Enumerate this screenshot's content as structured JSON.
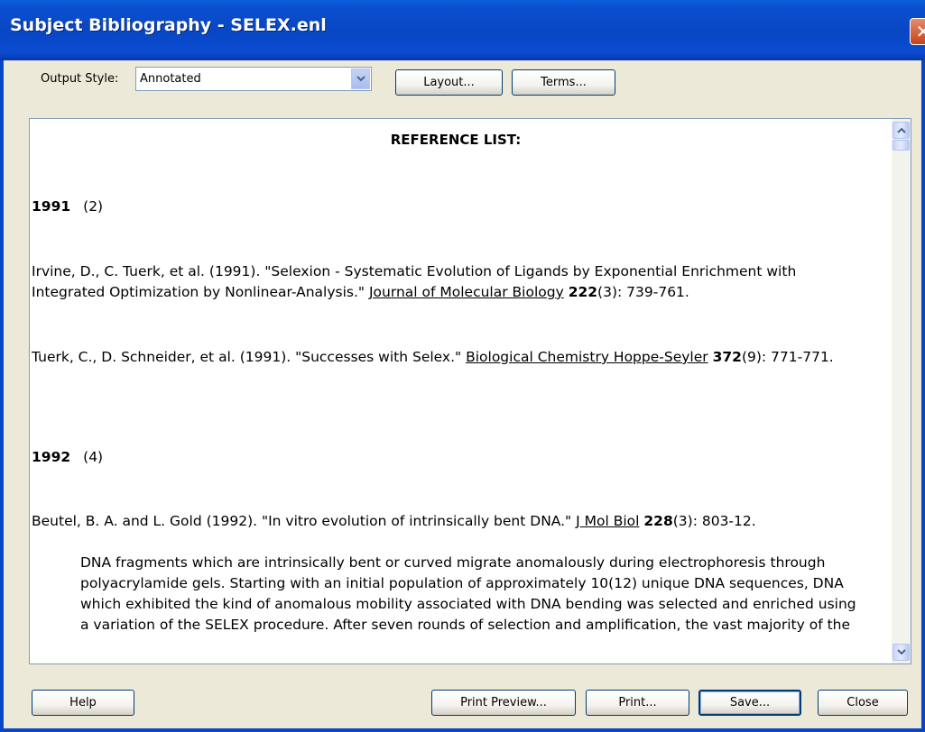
{
  "window": {
    "title": "Subject Bibliography - SELEX.enl",
    "close_glyph": "✕"
  },
  "toolbar": {
    "output_style_label": "Output Style:",
    "output_style_value": "Annotated",
    "layout_label": "Layout...",
    "terms_label": "Terms..."
  },
  "document": {
    "heading": "REFERENCE LIST:",
    "groups": [
      {
        "year": "1991",
        "count": "(2)",
        "refs": [
          {
            "authors": "Irvine, D., C. Tuerk, et al. (1991). \"Selexion - Systematic Evolution of Ligands by Exponential Enrichment with Integrated Optimization by Nonlinear-Analysis.\" ",
            "journal": "Journal of Molecular Biology",
            "volume": "222",
            "issue_pages": "(3): 739-761."
          },
          {
            "authors": "Tuerk, C., D. Schneider, et al. (1991). \"Successes with Selex.\" ",
            "journal": "Biological Chemistry Hoppe-Seyler",
            "volume": "372",
            "issue_pages": "(9): 771-771."
          }
        ]
      },
      {
        "year": "1992",
        "count": "(4)",
        "refs": [
          {
            "authors": "Beutel, B. A. and L. Gold (1992). \"In vitro evolution of intrinsically bent DNA.\" ",
            "journal": "J Mol Biol",
            "volume": "228",
            "issue_pages": "(3): 803-12.",
            "abstract": "DNA fragments which are intrinsically bent or curved migrate anomalously during electrophoresis through polyacrylamide gels. Starting with an initial population of approximately 10(12) unique DNA sequences, DNA which exhibited the kind of anomalous mobility associated with DNA bending was selected and enriched using a variation of the SELEX procedure. After seven rounds of selection and amplification, the vast majority of the"
          }
        ]
      }
    ]
  },
  "footer": {
    "help_label": "Help",
    "print_preview_label": "Print Preview...",
    "print_label": "Print...",
    "save_label": "Save...",
    "close_label": "Close"
  },
  "icons": {
    "dropdown": "chevron-down-icon",
    "scroll_up": "scroll-up-arrow-icon",
    "scroll_down": "scroll-down-arrow-icon",
    "close": "close-icon"
  }
}
